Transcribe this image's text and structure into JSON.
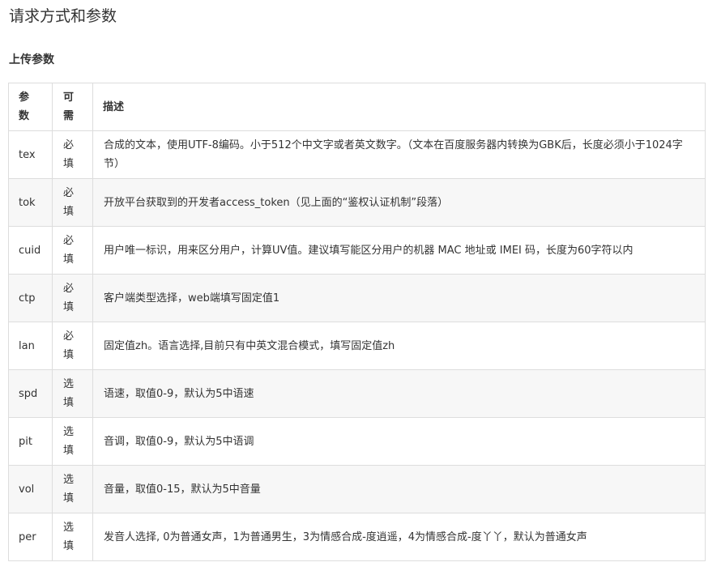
{
  "section_title": "请求方式和参数",
  "subsection_title": "上传参数",
  "table": {
    "headers": [
      "参数",
      "可需",
      "描述"
    ],
    "rows": [
      {
        "name": "tex",
        "required": "必填",
        "description": "合成的文本，使用UTF-8编码。小于512个中文字或者英文数字。（文本在百度服务器内转换为GBK后，长度必须小于1024字节）"
      },
      {
        "name": "tok",
        "required": "必填",
        "description": "开放平台获取到的开发者access_token（见上面的“鉴权认证机制”段落）"
      },
      {
        "name": "cuid",
        "required": "必填",
        "description": "用户唯一标识，用来区分用户，计算UV值。建议填写能区分用户的机器 MAC 地址或 IMEI 码，长度为60字符以内"
      },
      {
        "name": "ctp",
        "required": "必填",
        "description": "客户端类型选择，web端填写固定值1"
      },
      {
        "name": "lan",
        "required": "必填",
        "description": "固定值zh。语言选择,目前只有中英文混合模式，填写固定值zh"
      },
      {
        "name": "spd",
        "required": "选填",
        "description": "语速，取值0-9，默认为5中语速"
      },
      {
        "name": "pit",
        "required": "选填",
        "description": "音调，取值0-9，默认为5中语调"
      },
      {
        "name": "vol",
        "required": "选填",
        "description": "音量，取值0-15，默认为5中音量"
      },
      {
        "name": "per",
        "required": "选填",
        "description": "发音人选择, 0为普通女声，1为普通男生，3为情感合成-度逍遥，4为情感合成-度丫丫，默认为普通女声"
      }
    ]
  }
}
